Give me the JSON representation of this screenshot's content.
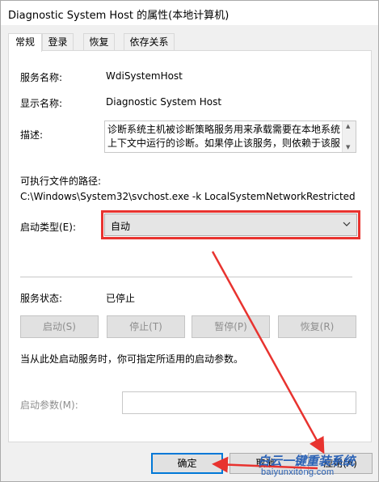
{
  "window": {
    "title": "Diagnostic System Host 的属性(本地计算机)"
  },
  "tabs": [
    {
      "label": "常规"
    },
    {
      "label": "登录"
    },
    {
      "label": "恢复"
    },
    {
      "label": "依存关系"
    }
  ],
  "general": {
    "service_name_label": "服务名称:",
    "service_name_value": "WdiSystemHost",
    "display_name_label": "显示名称:",
    "display_name_value": "Diagnostic System Host",
    "description_label": "描述:",
    "description_text": "诊断系统主机被诊断策略服务用来承载需要在本地系统上下文中运行的诊断。如果停止该服务，则依赖于该服",
    "exe_path_label": "可执行文件的路径:",
    "exe_path_value": "C:\\Windows\\System32\\svchost.exe -k LocalSystemNetworkRestricted",
    "startup_type_label": "启动类型(E):",
    "startup_type_value": "自动",
    "service_status_label": "服务状态:",
    "service_status_value": "已停止",
    "buttons": {
      "start": "启动(S)",
      "stop": "停止(T)",
      "pause": "暂停(P)",
      "resume": "恢复(R)"
    },
    "hint_text": "当从此处启动服务时，你可指定所适用的启动参数。",
    "start_params_label": "启动参数(M):",
    "start_params_value": ""
  },
  "dialog_buttons": {
    "ok": "确定",
    "cancel": "取消",
    "apply": "应用(A)"
  },
  "watermark": {
    "line1": "白云一键重装系统",
    "line2": "baiyunxitong.com"
  },
  "colors": {
    "highlight": "#e8332f",
    "focus": "#0078d7",
    "watermark": "#2b62b5"
  }
}
